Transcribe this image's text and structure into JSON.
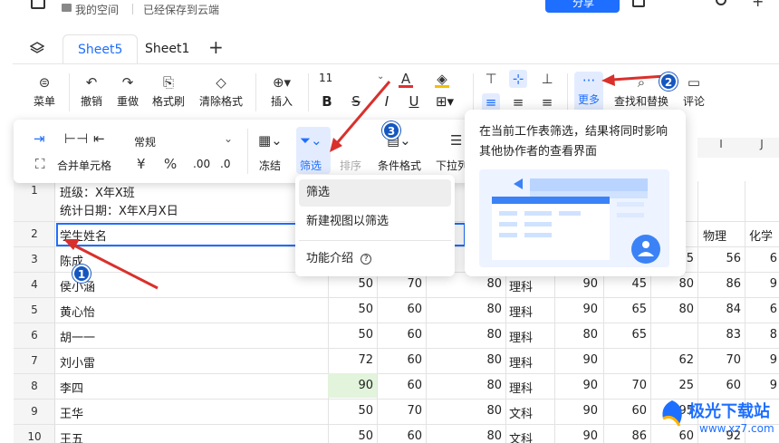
{
  "header": {
    "space_label": "我的空间",
    "saved_label": "已经保存到云端",
    "share_label": "分享"
  },
  "tabs": [
    {
      "label": "Sheet5",
      "active": true
    },
    {
      "label": "Sheet1",
      "active": false
    }
  ],
  "toolbar": {
    "menu": "菜单",
    "undo": "撤销",
    "redo": "重做",
    "format_painter": "格式刷",
    "clear_format": "清除格式",
    "insert": "插入",
    "font_size": "11",
    "more": "更多",
    "find_replace": "查找和替换",
    "comment": "评论"
  },
  "toolbar2": {
    "merge_cells": "合并单元格",
    "number_format": "常规",
    "yuan": "¥",
    "percent": "%",
    "freeze": "冻结",
    "filter": "筛选",
    "sort": "排序",
    "conditional_format": "条件格式",
    "dropdown_list": "下拉列"
  },
  "column_headers": [
    {
      "label": "I"
    },
    {
      "label": "J"
    }
  ],
  "sheet": {
    "row1_line1": "班级：X年X班",
    "row1_line2": "统计日期：X年X月X日",
    "row2_name": "学生姓名",
    "row2_physics": "物理",
    "row2_chemistry": "化学",
    "row_numbers": [
      "1",
      "2",
      "3",
      "4",
      "5",
      "6",
      "7",
      "8",
      "9",
      "10"
    ],
    "rows": [
      {
        "num": "3",
        "name": "陈成",
        "c1": "",
        "c2": "",
        "c3": "",
        "c4": "",
        "c5": "",
        "c6": "",
        "c7": "95",
        "c8": "56",
        "c9": "6"
      },
      {
        "num": "4",
        "name": "侯小涵",
        "c1": "50",
        "c2": "70",
        "c3": "80",
        "c4": "理科",
        "c5": "90",
        "c6": "45",
        "c7": "80",
        "c8": "86",
        "c9": "9"
      },
      {
        "num": "5",
        "name": "黄心怡",
        "c1": "50",
        "c2": "60",
        "c3": "80",
        "c4": "理科",
        "c5": "90",
        "c6": "65",
        "c7": "80",
        "c8": "84",
        "c9": "6"
      },
      {
        "num": "6",
        "name": "胡一一",
        "c1": "50",
        "c2": "60",
        "c3": "80",
        "c4": "理科",
        "c5": "80",
        "c6": "65",
        "c7": "",
        "c8": "83",
        "c9": "8"
      },
      {
        "num": "7",
        "name": "刘小雷",
        "c1": "72",
        "c2": "60",
        "c3": "80",
        "c4": "理科",
        "c5": "90",
        "c6": "",
        "c7": "62",
        "c8": "70",
        "c9": "9"
      },
      {
        "num": "8",
        "name": "李四",
        "c1": "90",
        "c2": "60",
        "c3": "80",
        "c4": "理科",
        "c5": "90",
        "c6": "70",
        "c7": "25",
        "c8": "60",
        "c9": "9"
      },
      {
        "num": "9",
        "name": "王华",
        "c1": "50",
        "c2": "70",
        "c3": "80",
        "c4": "文科",
        "c5": "90",
        "c6": "60",
        "c7": "95",
        "c8": "",
        "c9": ""
      },
      {
        "num": "10",
        "name": "王五",
        "c1": "50",
        "c2": "60",
        "c3": "80",
        "c4": "文科",
        "c5": "90",
        "c6": "86",
        "c7": "60",
        "c8": "92",
        "c9": ""
      }
    ]
  },
  "filter_dropdown": {
    "items": [
      "筛选",
      "新建视图以筛选",
      "功能介绍"
    ]
  },
  "tooltip": {
    "text": "在当前工作表筛选，结果将同时影响其他协作者的查看界面"
  },
  "badges": [
    "1",
    "2",
    "3"
  ],
  "watermark": {
    "main": "极光下载站",
    "sub": "www.xz7.com"
  },
  "colors": {
    "accent": "#1e6fff",
    "highlight_cell": "#e2f4dc",
    "arrow": "#d9302c"
  }
}
